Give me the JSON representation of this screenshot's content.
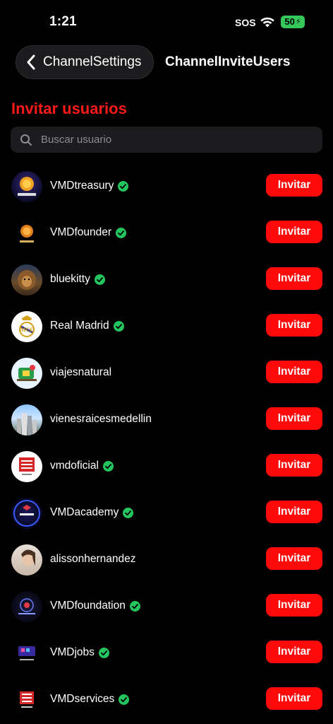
{
  "status_bar": {
    "time": "1:21",
    "sos": "SOS",
    "battery": "50"
  },
  "nav": {
    "back_label": "ChannelSettings",
    "title": "ChannelInviteUsers"
  },
  "page": {
    "title": "Invitar usuarios"
  },
  "search": {
    "placeholder": "Buscar usuario"
  },
  "invite_label": "Invitar",
  "users": [
    {
      "name": "VMDtreasury",
      "verified": true,
      "avatar": "vmd-treasury-logo"
    },
    {
      "name": "VMDfounder",
      "verified": true,
      "avatar": "vmd-founder-logo"
    },
    {
      "name": "bluekitty",
      "verified": true,
      "avatar": "lion-photo"
    },
    {
      "name": "Real Madrid",
      "verified": true,
      "avatar": "real-madrid-crest"
    },
    {
      "name": "viajesnatural",
      "verified": false,
      "avatar": "travel-illustration"
    },
    {
      "name": "vienesraicesmedellin",
      "verified": false,
      "avatar": "city-photo"
    },
    {
      "name": "vmdoficial",
      "verified": true,
      "avatar": "viral-media-digital-logo"
    },
    {
      "name": "VMDacademy",
      "verified": true,
      "avatar": "vmd-academy-logo"
    },
    {
      "name": "alissonhernandez",
      "verified": false,
      "avatar": "person-photo"
    },
    {
      "name": "VMDfoundation",
      "verified": true,
      "avatar": "vmd-foundation-logo"
    },
    {
      "name": "VMDjobs",
      "verified": true,
      "avatar": "vmd-jobs-logo"
    },
    {
      "name": "VMDservices",
      "verified": true,
      "avatar": "viral-media-services-logo"
    }
  ],
  "colors": {
    "accent": "#ff0a0a",
    "title": "#ff1a1a",
    "verified": "#22c55e",
    "battery": "#34c759"
  }
}
